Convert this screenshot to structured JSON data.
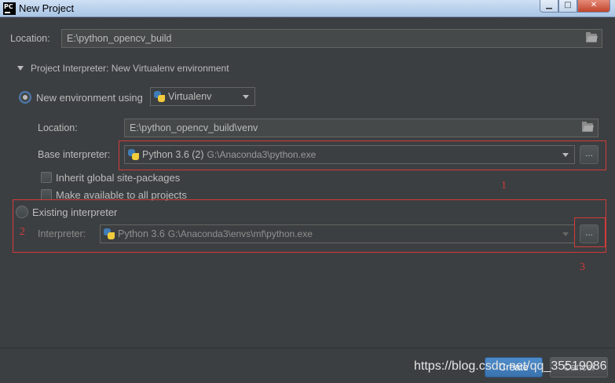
{
  "window": {
    "title": "New Project"
  },
  "location": {
    "label": "Location:",
    "value": "E:\\python_opencv_build"
  },
  "interpreter_section": {
    "title": "Project Interpreter: New Virtualenv environment"
  },
  "new_env": {
    "radio_label": "New environment using",
    "tool": "Virtualenv",
    "location_label": "Location:",
    "location_value": "E:\\python_opencv_build\\venv",
    "base_label": "Base interpreter:",
    "base_name": "Python 3.6 (2)",
    "base_path": "G:\\Anaconda3\\python.exe",
    "browse_label": "...",
    "inherit_label": "Inherit global site-packages",
    "available_label": "Make available to all projects"
  },
  "existing": {
    "radio_label": "Existing interpreter",
    "interpreter_label": "Interpreter:",
    "interp_name": "Python 3.6",
    "interp_path": "G:\\Anaconda3\\envs\\mf\\python.exe",
    "browse_label": "..."
  },
  "annotations": [
    "1",
    "2",
    "3"
  ],
  "buttons": {
    "create": "Create",
    "cancel": "Cancel"
  },
  "watermark": "https://blog.csdn.net/qq_35519086",
  "icons": [
    "app-icon",
    "folder-icon",
    "python-icon",
    "chevron-down-icon",
    "minimize-icon",
    "maximize-icon",
    "close-icon"
  ],
  "colors": {
    "background": "#3c3f41",
    "accent": "#4b7bb5",
    "annotation": "#d33a3a"
  }
}
